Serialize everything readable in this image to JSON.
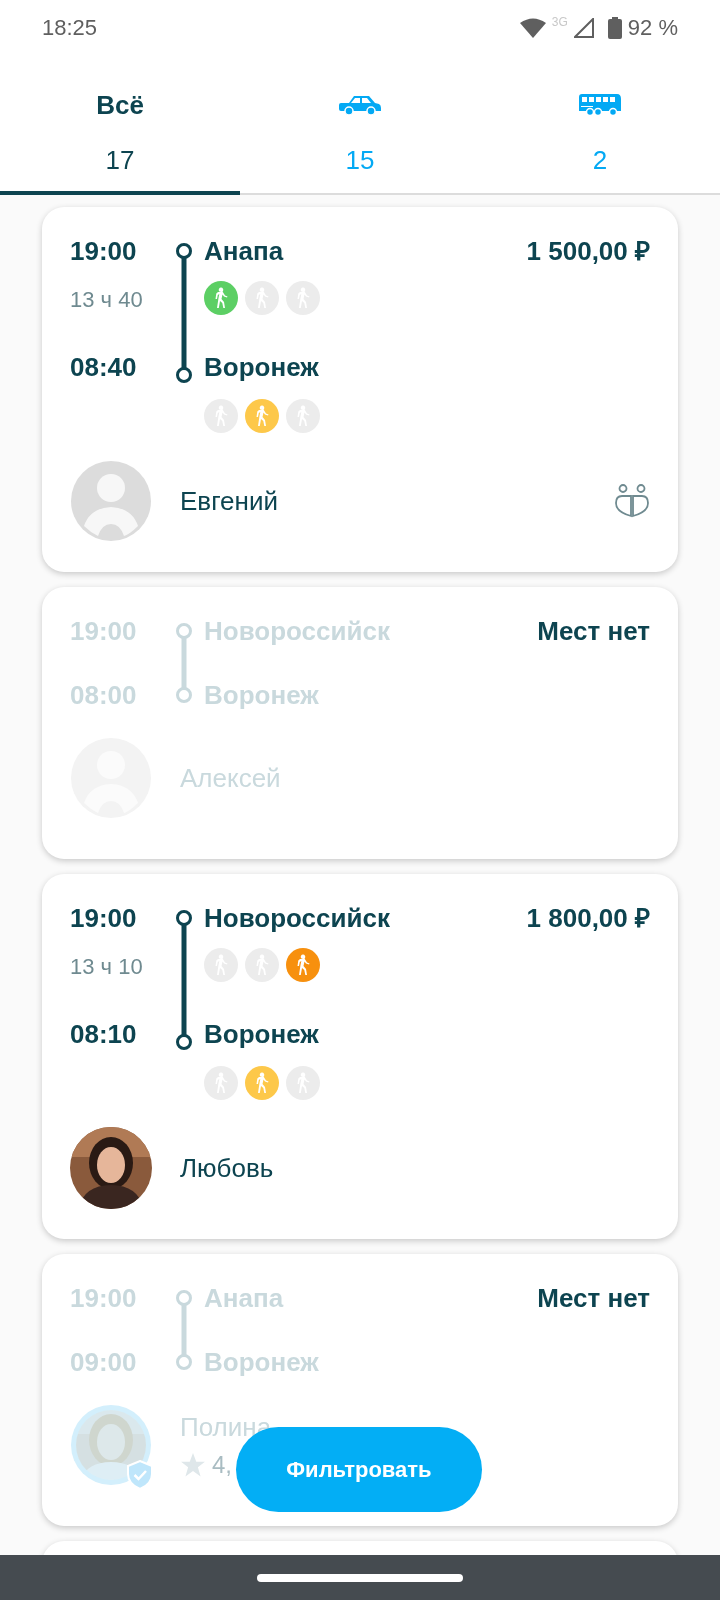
{
  "status_bar": {
    "time": "18:25",
    "network": "3G",
    "battery": "92 %"
  },
  "tabs": [
    {
      "kind": "text",
      "label": "Всё",
      "count": "17",
      "selected": true
    },
    {
      "kind": "car",
      "count": "15",
      "selected": false
    },
    {
      "kind": "bus",
      "count": "2",
      "selected": false
    }
  ],
  "trips": [
    {
      "kind": "available",
      "depart_time": "19:00",
      "duration": "13 ч 40",
      "arrive_time": "08:40",
      "from": "Анапа",
      "to": "Воронеж",
      "price": "1 500,00 ₽",
      "from_seats": [
        {
          "occupied": true,
          "color": "#5ccf64"
        },
        {
          "occupied": false
        },
        {
          "occupied": false
        }
      ],
      "to_seats": [
        {
          "occupied": false
        },
        {
          "occupied": true,
          "color": "#fdc84a"
        },
        {
          "occupied": false
        }
      ],
      "driver": {
        "name": "Евгений",
        "avatar": {
          "kind": "placeholder"
        }
      },
      "two_seat_badge": true
    },
    {
      "kind": "full",
      "depart_time": "19:00",
      "arrive_time": "08:00",
      "from": "Новороссийск",
      "to": "Воронеж",
      "price": "Мест нет",
      "driver": {
        "name": "Алексей",
        "avatar": {
          "kind": "placeholder"
        }
      }
    },
    {
      "kind": "available",
      "depart_time": "19:00",
      "duration": "13 ч 10",
      "arrive_time": "08:10",
      "from": "Новороссийск",
      "to": "Воронеж",
      "price": "1 800,00 ₽",
      "from_seats": [
        {
          "occupied": false
        },
        {
          "occupied": false
        },
        {
          "occupied": true,
          "color": "#f7900e"
        }
      ],
      "to_seats": [
        {
          "occupied": false
        },
        {
          "occupied": true,
          "color": "#fdc84a"
        },
        {
          "occupied": false
        }
      ],
      "driver": {
        "name": "Любовь"
      }
    },
    {
      "kind": "full",
      "depart_time": "19:00",
      "arrive_time": "09:00",
      "from": "Анапа",
      "to": "Воронеж",
      "price": "Мест нет",
      "driver": {
        "name": "Полина",
        "verified": true,
        "rating": "4,"
      }
    }
  ],
  "filter_button": "Фильтровать"
}
